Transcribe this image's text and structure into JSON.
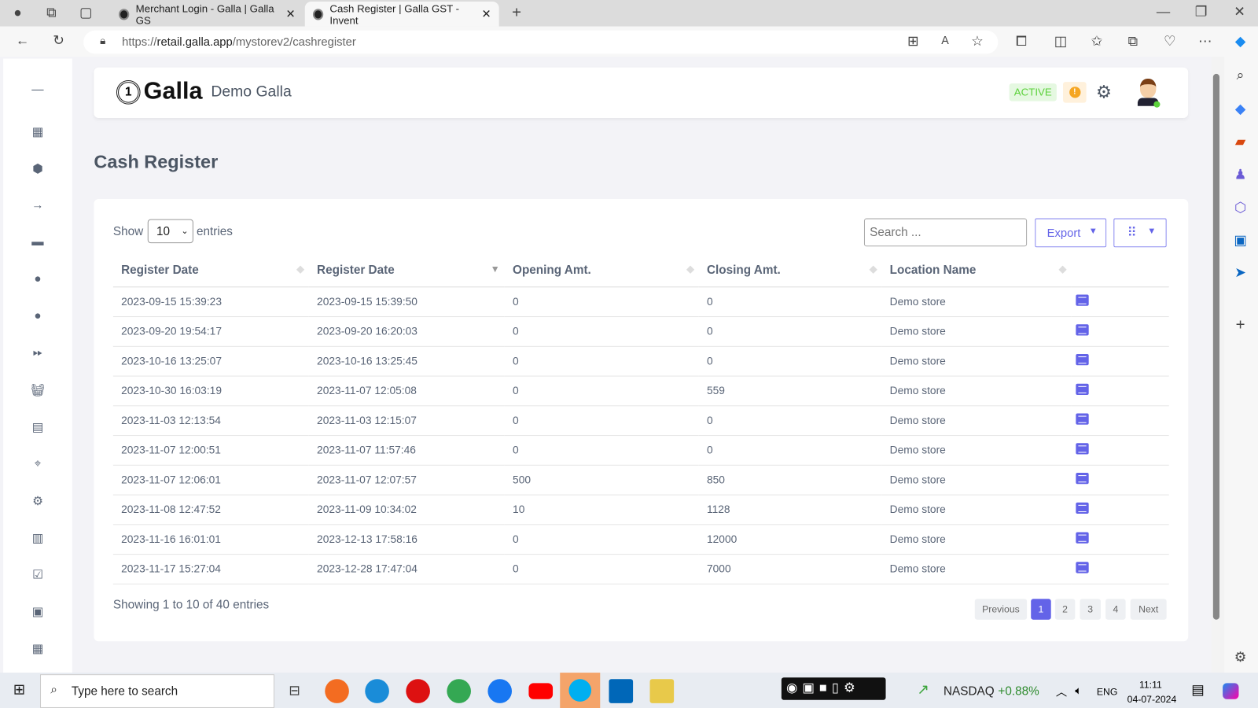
{
  "browser": {
    "tabs": [
      {
        "title": "Merchant Login - Galla | Galla GS"
      },
      {
        "title": "Cash Register | Galla GST - Invent"
      }
    ],
    "url_prefix": "https://",
    "url_host": "retail.galla.app",
    "url_path": "/mystorev2/cashregister"
  },
  "header": {
    "logo": "Galla",
    "store_name": "Demo Galla",
    "status": "ACTIVE"
  },
  "page": {
    "title": "Cash Register"
  },
  "controls": {
    "show_label": "Show",
    "entries_label": "entries",
    "page_size": "10",
    "search_placeholder": "Search ...",
    "export_label": "Export"
  },
  "table": {
    "columns": [
      "Register Date",
      "Register Date",
      "Opening Amt.",
      "Closing Amt.",
      "Location Name"
    ],
    "rows": [
      [
        "2023-09-15 15:39:23",
        "2023-09-15 15:39:50",
        "0",
        "0",
        "Demo store"
      ],
      [
        "2023-09-20 19:54:17",
        "2023-09-20 16:20:03",
        "0",
        "0",
        "Demo store"
      ],
      [
        "2023-10-16 13:25:07",
        "2023-10-16 13:25:45",
        "0",
        "0",
        "Demo store"
      ],
      [
        "2023-10-30 16:03:19",
        "2023-11-07 12:05:08",
        "0",
        "559",
        "Demo store"
      ],
      [
        "2023-11-03 12:13:54",
        "2023-11-03 12:15:07",
        "0",
        "0",
        "Demo store"
      ],
      [
        "2023-11-07 12:00:51",
        "2023-11-07 11:57:46",
        "0",
        "0",
        "Demo store"
      ],
      [
        "2023-11-07 12:06:01",
        "2023-11-07 12:07:57",
        "500",
        "850",
        "Demo store"
      ],
      [
        "2023-11-08 12:47:52",
        "2023-11-09 10:34:02",
        "10",
        "1128",
        "Demo store"
      ],
      [
        "2023-11-16 16:01:01",
        "2023-12-13 17:58:16",
        "0",
        "12000",
        "Demo store"
      ],
      [
        "2023-11-17 15:27:04",
        "2023-12-28 17:47:04",
        "0",
        "7000",
        "Demo store"
      ]
    ]
  },
  "footer": {
    "info": "Showing 1 to 10 of 40 entries",
    "previous": "Previous",
    "pages": [
      "1",
      "2",
      "3",
      "4"
    ],
    "next": "Next",
    "current_page": "1"
  },
  "taskbar": {
    "search_placeholder": "Type here to search",
    "ticker": "NASDAQ",
    "ticker_change": "+0.88%",
    "lang": "ENG",
    "time": "11:11",
    "date": "04-07-2024"
  },
  "colors": {
    "accent": "#6363e8",
    "active_badge": "#5cd13b",
    "warning": "#f5a623"
  }
}
